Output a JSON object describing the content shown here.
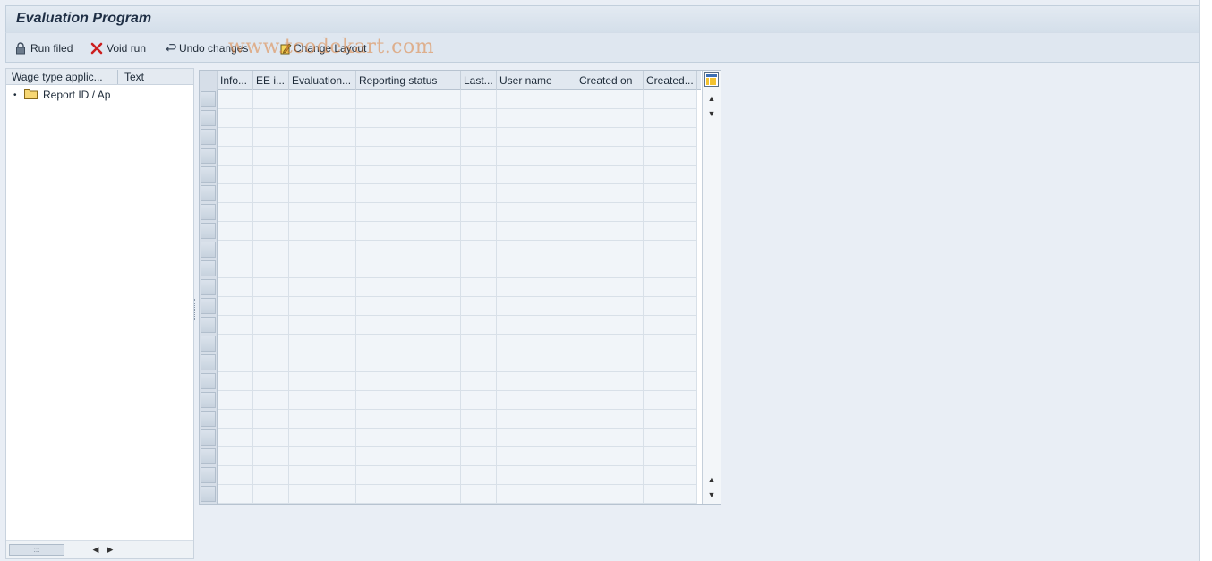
{
  "window": {
    "title": "Evaluation Program"
  },
  "toolbar": {
    "run_filed": "Run filed",
    "void_run": "Void run",
    "undo_changes": "Undo changes",
    "change_layout": "Change Layout"
  },
  "watermark": "www.tcodekart.com",
  "tree": {
    "columns": [
      "Wage type applic...",
      "Text"
    ],
    "nodes": [
      {
        "label": "Report ID / Ap",
        "icon": "folder-icon"
      }
    ]
  },
  "grid": {
    "columns": [
      "Info...",
      "EE i...",
      "Evaluation...",
      "Reporting status",
      "Last...",
      "User name",
      "Created on",
      "Created..."
    ],
    "row_count": 22,
    "rows": []
  },
  "colors": {
    "background": "#e9eef5",
    "title_text": "#1f2f45",
    "void_icon": "#cc1f1f",
    "watermark": "#dc823c"
  }
}
